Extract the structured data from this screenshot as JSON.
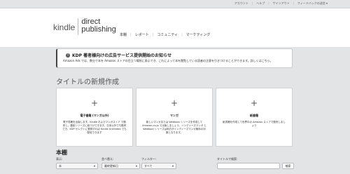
{
  "topbar": {
    "links": [
      "アカウント",
      "ヘルプ",
      "サインアウト"
    ],
    "feedback": "フィードバックの送信"
  },
  "header": {
    "logo_kindle": "kindle",
    "logo_direct": "direct",
    "logo_publishing": "publishing",
    "nav": [
      "本棚",
      "レポート",
      "コミュニティ",
      "マーケティング"
    ]
  },
  "notice": {
    "title": "KDP 著者様向けの広告サービス提供開始のお知らせ",
    "body": "Amazon Ads では、数分で本を Amazon ストアの目立つ場所に表示でき、これによって本を閲覧している読者の注意を引きつけることができます。詳しくはこちら。"
  },
  "section_title": "タイトルの新規作成",
  "cards": [
    {
      "title": "電子書籍 (マンガ以外)",
      "desc": "電子書籍を出版します。Kindle およびマンガストア で販売し、雑誌シリーズに紐づけできます。日本以外でも販売でき、KDP セレクトに登録すれば Kindle Unlimited でも配信できます"
    },
    {
      "title": "マンガ",
      "desc": "新しいマンガまたは Webtoon シリーズを作成して Amazon.co.jp で出版しましょう。インディーズマンガ と Webtoon シリーズは両方がインディーズマンガ無料の対象となります。"
    },
    {
      "title": "紙書籍",
      "desc": "紙書籍を作成して世界中の Amazon ストアで販売しましょう"
    }
  ],
  "books": {
    "title": "本棚",
    "filters": [
      {
        "label": "表示:",
        "value": "本"
      },
      {
        "label": "並べ替え:",
        "value": "最終更新日"
      },
      {
        "label": "フィルター:",
        "value": "すべて"
      }
    ],
    "search_label": "タイトルで検索:",
    "search_button": "検索"
  }
}
